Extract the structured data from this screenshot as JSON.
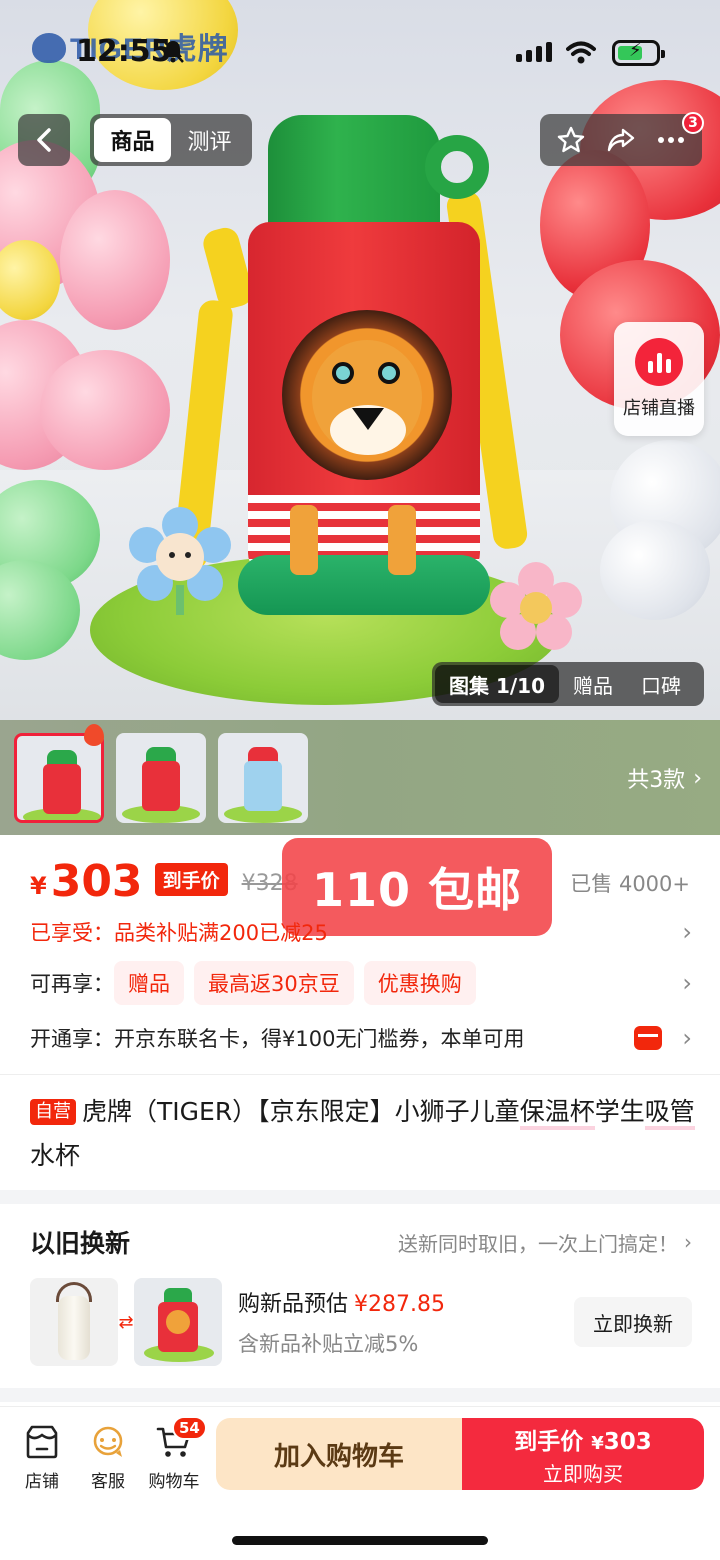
{
  "status_bar": {
    "time": "12:55",
    "brand_logo": "TIGER虎牌",
    "icons": [
      "bell-off-icon",
      "signal-icon",
      "wifi-icon",
      "battery-charging-icon"
    ]
  },
  "top_nav": {
    "tabs": [
      {
        "label": "商品",
        "active": true
      },
      {
        "label": "测评",
        "active": false
      }
    ],
    "more_badge": "3",
    "actions": [
      "star-icon",
      "share-icon",
      "more-icon"
    ]
  },
  "live_chip": {
    "label": "店铺直播"
  },
  "gallery": {
    "tabs": [
      {
        "label": "图集 1/10",
        "active": true
      },
      {
        "label": "赠品",
        "active": false
      },
      {
        "label": "口碑",
        "active": false
      }
    ]
  },
  "thumbnails": {
    "count_label": "共3款",
    "items": [
      {
        "variant": "lion",
        "body_color": "#e8303a",
        "selected": true
      },
      {
        "variant": "giraffe",
        "body_color": "#e8303a",
        "selected": false
      },
      {
        "variant": "panda",
        "body_color": "#9fd2ee",
        "selected": false
      }
    ]
  },
  "price": {
    "currency": "¥",
    "value": "303",
    "tag": "到手价",
    "original": "¥328",
    "sold": "已售 4000+"
  },
  "promo_overlay": "110 包邮",
  "subsidy": "已享受：品类补贴满200已减25",
  "enjoy_more": {
    "label": "可再享：",
    "chips": [
      "赠品",
      "最高返30京豆",
      "优惠换购"
    ]
  },
  "card_offer": "开通享：开京东联名卡，得¥100无门槛券，本单可用",
  "product": {
    "self_tag": "自营",
    "title_part1": "虎牌（TIGER）【京东限定】小狮子儿童",
    "title_hl1": "保温杯",
    "title_part2": "学生",
    "title_hl2": "吸管",
    "title_part3": "水杯"
  },
  "trade_in": {
    "title": "以旧换新",
    "note": "送新同时取旧，一次上门搞定！",
    "estimate_label": "购新品预估",
    "estimate_value": "¥287.85",
    "subsidy_text": "含新品补贴立减5%",
    "button": "立即换新"
  },
  "bottom_bar": {
    "shop": "店铺",
    "service": "客服",
    "cart": "购物车",
    "cart_badge": "54",
    "add_to_cart": "加入购物车",
    "buy_price_label": "到手价",
    "buy_price_currency": "¥",
    "buy_price_value": "303",
    "buy_now": "立即购买"
  },
  "colors": {
    "accent": "#f2270c",
    "buy_button": "#f42a3e",
    "cart_button": "#fde5c6",
    "promo_overlay": "#f24348"
  }
}
